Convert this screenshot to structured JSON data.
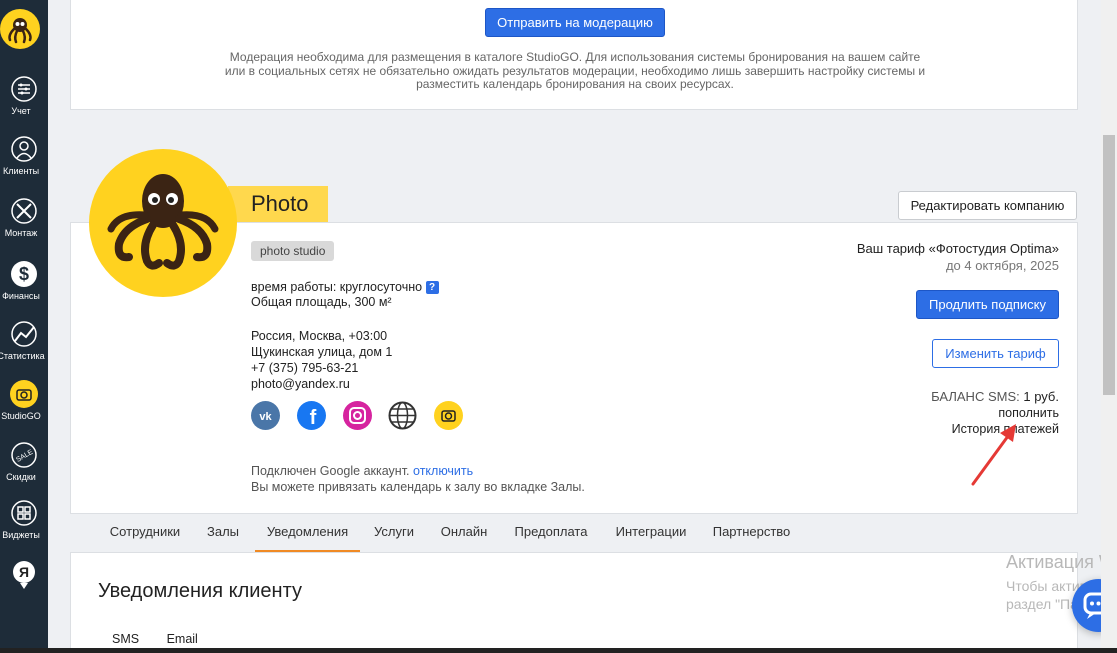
{
  "sidebar": {
    "items": [
      {
        "label": "Учет",
        "icon": "abacus-icon"
      },
      {
        "label": "Клиенты",
        "icon": "user-icon"
      },
      {
        "label": "Монтаж",
        "icon": "tools-icon"
      },
      {
        "label": "Финансы",
        "icon": "dollar-icon"
      },
      {
        "label": "Статистика",
        "icon": "chart-icon"
      },
      {
        "label": "StudioGO",
        "icon": "camera-icon"
      },
      {
        "label": "Скидки",
        "icon": "sale-tag-icon"
      },
      {
        "label": "Виджеты",
        "icon": "widgets-icon"
      },
      {
        "label": "",
        "icon": "yandex-icon"
      }
    ]
  },
  "moderation": {
    "button_label": "Отправить на модерацию",
    "note": "Модерация необходима для размещения в каталоге StudioGO. Для использования системы бронирования на вашем сайте или в социальных сетях не обязательно ожидать результатов модерации, необходимо лишь завершить настройку системы и разместить календарь бронирования на своих ресурсах."
  },
  "company": {
    "name": "Photo",
    "edit_button": "Редактировать компанию",
    "category": "photo studio",
    "hours": "время работы: круглосуточно",
    "area": "Общая площадь, 300 м²",
    "location": "Россия, Москва, +03:00",
    "address": "Щукинская улица, дом 1",
    "phone": "+7 (375) 795-63-21",
    "email": "photo@yandex.ru",
    "socials": [
      "vk-icon",
      "facebook-icon",
      "instagram-icon",
      "globe-icon",
      "studiogo-icon"
    ],
    "google_text": "Подключен Google аккаунт.",
    "google_link": "отключить",
    "google_hint": "Вы можете привязать календарь к залу во вкладке Залы."
  },
  "tariff": {
    "title": "Ваш тариф «Фотостудия Optima»",
    "until": "до 4 октября, 2025",
    "extend_button": "Продлить подписку",
    "change_button": "Изменить тариф",
    "sms_label": "БАЛАНС SMS:",
    "sms_value": "1 руб.",
    "topup_link": "пополнить",
    "history_link": "История платежей"
  },
  "tabs": [
    "Сотрудники",
    "Залы",
    "Уведомления",
    "Услуги",
    "Онлайн",
    "Предоплата",
    "Интеграции",
    "Партнерство"
  ],
  "active_tab": "Уведомления",
  "notifications": {
    "title": "Уведомления клиенту",
    "subtabs": [
      "SMS",
      "Email"
    ]
  },
  "watermark": {
    "line1": "Активация W",
    "line2": "Чтобы активиро",
    "line3": "раздел \"Параме"
  },
  "colors": {
    "accent": "#2d6ee5",
    "brand_yellow": "#ffd21f",
    "sidebar": "#1e2c39",
    "tab_active": "#f08a24"
  }
}
